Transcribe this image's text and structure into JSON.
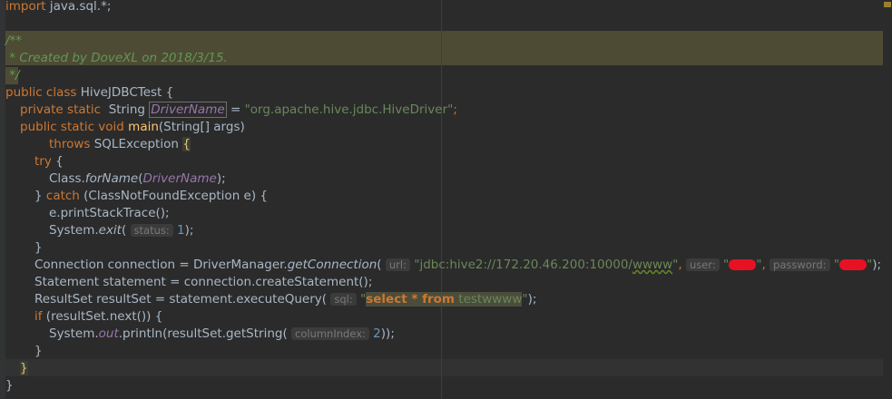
{
  "lines": [
    {
      "import": "import",
      "rest": " java.sql.*;"
    },
    {
      "c1": "/**"
    },
    {
      "c2": " * Created by DoveXL on 2018/3/15."
    },
    {
      "c3": " */"
    },
    {
      "public": "public",
      "class": "class",
      "name": " HiveJDBCTest {"
    },
    {
      "private": "private",
      "static": "static",
      "type": "  String ",
      "field": "DriverName",
      "eq": " = ",
      "str": "\"org.apache.hive.jdbc.HiveDriver\"",
      "semi": ";"
    },
    {
      "public": "public",
      "static": "static",
      "void": "void",
      "main": "main",
      "args": "(String[] args)"
    },
    {
      "throws": "throws",
      "exc": " SQLException ",
      "brace": "{"
    },
    {
      "try": "try",
      "brace": " {"
    },
    {
      "cls": "Class.",
      "forName": "forName",
      "open": "(",
      "field": "DriverName",
      "close": ");"
    },
    {
      "close": "} ",
      "catch": "catch",
      "rest": " (ClassNotFoundException e) {"
    },
    {
      "text": "e.printStackTrace();"
    },
    {
      "sys": "System.",
      "exit": "exit",
      "open": "( ",
      "hint": "status:",
      "num": " 1",
      "close": ");"
    },
    {
      "text": "}"
    },
    {
      "pre": "Connection connection = DriverManager.",
      "get": "getConnection",
      "open": "( ",
      "h1": "url:",
      "s1": " \"jdbc:hive2://172.20.46.200:10000/",
      "s1b": "wwww",
      "s1c": "\"",
      "comma1": ", ",
      "h2": "user:",
      "s2a": " \"",
      "s2b": "\"",
      "comma2": ", ",
      "h3": "password:",
      "s3a": " \"",
      "s3b": "\"",
      "close": ");"
    },
    {
      "text": "Statement statement = connection.createStatement();"
    },
    {
      "pre": "ResultSet resultSet = statement.executeQuery( ",
      "hint": "sql:",
      "q1": " \"",
      "sel1": "select * from",
      "sel2": " testwwww",
      "q2": "\"",
      "close": ");"
    },
    {
      "if": "if",
      "rest": " (resultSet.next()) {"
    },
    {
      "sys": "System.",
      "out": "out",
      "print": ".println(resultSet.getString( ",
      "hint": "columnIndex:",
      "num": " 2",
      "close": "));"
    },
    {
      "text": "}"
    },
    {
      "text": "}"
    },
    {
      "text": "}"
    }
  ],
  "colors": {
    "background": "#2b2b2b",
    "keyword": "#cc7832",
    "string": "#6a8759",
    "number": "#6897bb",
    "field": "#9876aa",
    "method": "#ffc66d",
    "comment": "#629755",
    "redaction": "#e81123"
  }
}
